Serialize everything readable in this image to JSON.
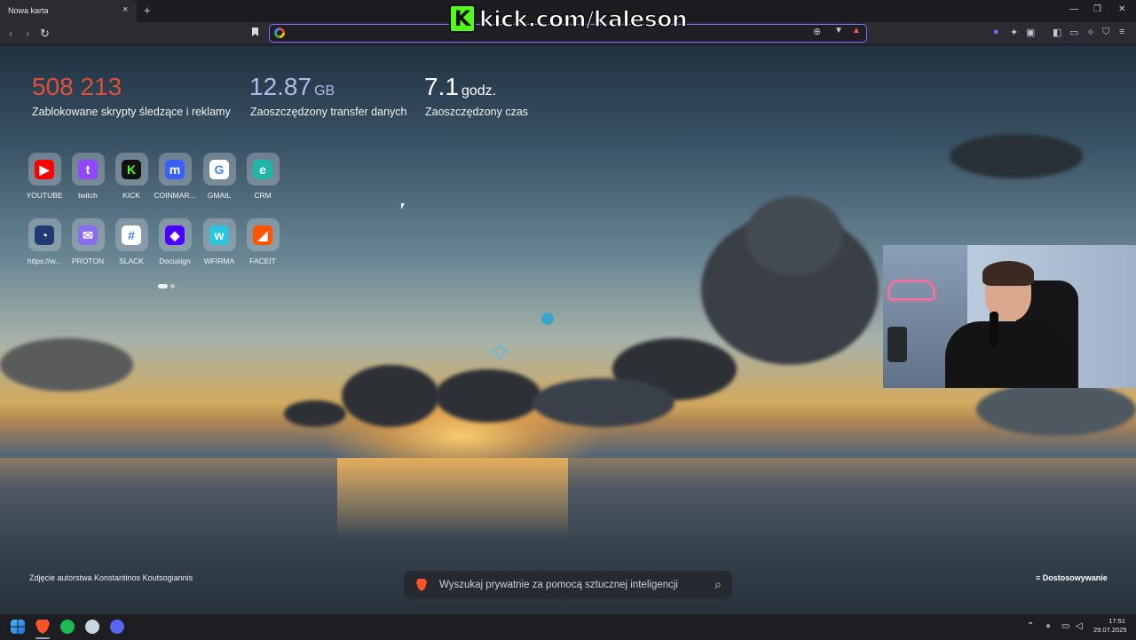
{
  "tab": {
    "title": "Nowa karta",
    "close": "×",
    "new": "+"
  },
  "window_controls": {
    "minimize": "—",
    "maximize": "❐",
    "close": "✕"
  },
  "toolbar": {
    "back": "‹",
    "forward": "›",
    "reload": "↻",
    "url_value": "",
    "zoom_icon": "zoom-icon",
    "shield_icon": "brave-shields-icon"
  },
  "overlay_banner": {
    "logo_letter": "K",
    "text": "kick.com/kaleson"
  },
  "stats": [
    {
      "value": "508 213",
      "unit": "",
      "label": "Zablokowane skrypty śledzące i reklamy",
      "color": "#e0503c"
    },
    {
      "value": "12.87",
      "unit": "GB",
      "label": "Zaoszczędzony transfer danych",
      "color": "#b4b8ea"
    },
    {
      "value": "7.1",
      "unit": "godz.",
      "label": "Zaoszczędzony czas",
      "color": "#ffffff"
    }
  ],
  "shortcuts_row1": [
    {
      "label": "YOUTUBE",
      "icon": "youtube-icon",
      "color": "#ff0000",
      "glyph": "▶"
    },
    {
      "label": "twitch",
      "icon": "twitch-icon",
      "color": "#9146ff",
      "glyph": "t"
    },
    {
      "label": "KICK",
      "icon": "kick-icon",
      "color": "#111111",
      "glyph": "K"
    },
    {
      "label": "COINMAR...",
      "icon": "coinmarketcap-icon",
      "color": "#3861fb",
      "glyph": "m"
    },
    {
      "label": "GMAIL",
      "icon": "google-icon",
      "color": "#ffffff",
      "glyph": "G"
    },
    {
      "label": "CRM",
      "icon": "crm-icon",
      "color": "#1fb6a6",
      "glyph": "e"
    }
  ],
  "shortcuts_row2": [
    {
      "label": "https://w...",
      "icon": "speedometer-icon",
      "color": "#1e3c72",
      "glyph": "◔"
    },
    {
      "label": "PROTON",
      "icon": "proton-mail-icon",
      "color": "#8a6cf0",
      "glyph": "✉"
    },
    {
      "label": "SLACK",
      "icon": "slack-icon",
      "color": "#ffffff",
      "glyph": "#"
    },
    {
      "label": "Docusign",
      "icon": "docusign-icon",
      "color": "#4c00ff",
      "glyph": "◆"
    },
    {
      "label": "WFIRMA",
      "icon": "wfirma-icon",
      "color": "#2dc4e0",
      "glyph": "w"
    },
    {
      "label": "FACEIT",
      "icon": "faceit-icon",
      "color": "#ff5500",
      "glyph": "◢"
    }
  ],
  "photo_credit": "Zdjęcie autorstwa Konstantinos Koutsogiannis",
  "search": {
    "placeholder": "Wyszukaj prywatnie za pomocą sztucznej inteligencji",
    "icon": "search-icon"
  },
  "customize": "≡ Dostosowywanie",
  "taskbar": {
    "apps": [
      {
        "name": "windows-start-icon",
        "color": "#3aa0f0"
      },
      {
        "name": "brave-browser-icon",
        "color": "#fb542b"
      },
      {
        "name": "spotify-icon",
        "color": "#1db954"
      },
      {
        "name": "steam-icon",
        "color": "#c7d5e0"
      },
      {
        "name": "discord-icon",
        "color": "#5865f2"
      }
    ],
    "tray": {
      "chevron": "⌃",
      "mic": "🎙",
      "network": "▭",
      "volume": "🔈"
    },
    "time": "17:51",
    "date": "29.07.2025"
  }
}
